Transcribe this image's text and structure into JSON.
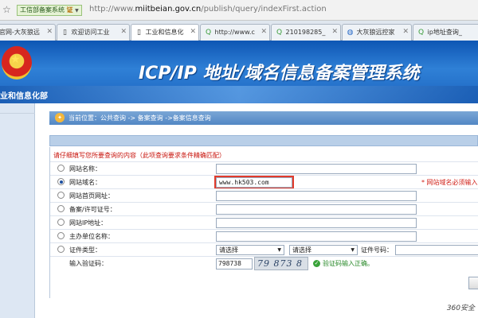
{
  "address_bar": {
    "site_badge": "工信部备案系统",
    "badge_seal": "证",
    "url_prefix": "http://www.",
    "url_domain": "miitbeian.gov.cn",
    "url_path": "/publish/query/indexFirst.action"
  },
  "tabs": [
    {
      "label": "官网-大灰狼远",
      "icon": "page-icon",
      "active": false
    },
    {
      "label": "欢迎访问工业",
      "icon": "page-icon",
      "active": false
    },
    {
      "label": "工业和信息化",
      "icon": "page-icon",
      "active": true
    },
    {
      "label": "http://www.c",
      "icon": "search-q-icon",
      "active": false
    },
    {
      "label": "210198285_",
      "icon": "search-q-icon",
      "active": false
    },
    {
      "label": "大灰狼远控家",
      "icon": "globe-icon",
      "active": false
    },
    {
      "label": "ip地址查询_",
      "icon": "search-q-icon",
      "active": false
    }
  ],
  "banner": {
    "ministry": "业和信息化部",
    "title": "ICP/IP 地址/域名信息备案管理系统"
  },
  "breadcrumb": "当前位置：公共查询 -> 备案查询 ->备案信息查询",
  "form": {
    "note": "请仔细填写您所要查询的内容（此项查询要求条件精确匹配）",
    "rows": [
      {
        "label": "网站名称：",
        "value": "",
        "selected": false
      },
      {
        "label": "网站域名：",
        "value": "www.hk503.com",
        "selected": true,
        "hint": "* 网站域名必须输入"
      },
      {
        "label": "网站首页网址：",
        "value": "",
        "selected": false
      },
      {
        "label": "备案/许可证号：",
        "value": "",
        "selected": false
      },
      {
        "label": "网站IP地址：",
        "value": "",
        "selected": false
      },
      {
        "label": "主办单位名称：",
        "value": "",
        "selected": false
      }
    ],
    "cert_row": {
      "label": "证件类型：",
      "select1": "请选择",
      "select2": "请选择",
      "cert_no_label": "证件号码："
    },
    "captcha_row": {
      "label": "输入验证码：",
      "value": "798738",
      "captcha_text": "79 873 8",
      "ok_text": "验证码输入正确。"
    }
  },
  "footer": "360安全"
}
